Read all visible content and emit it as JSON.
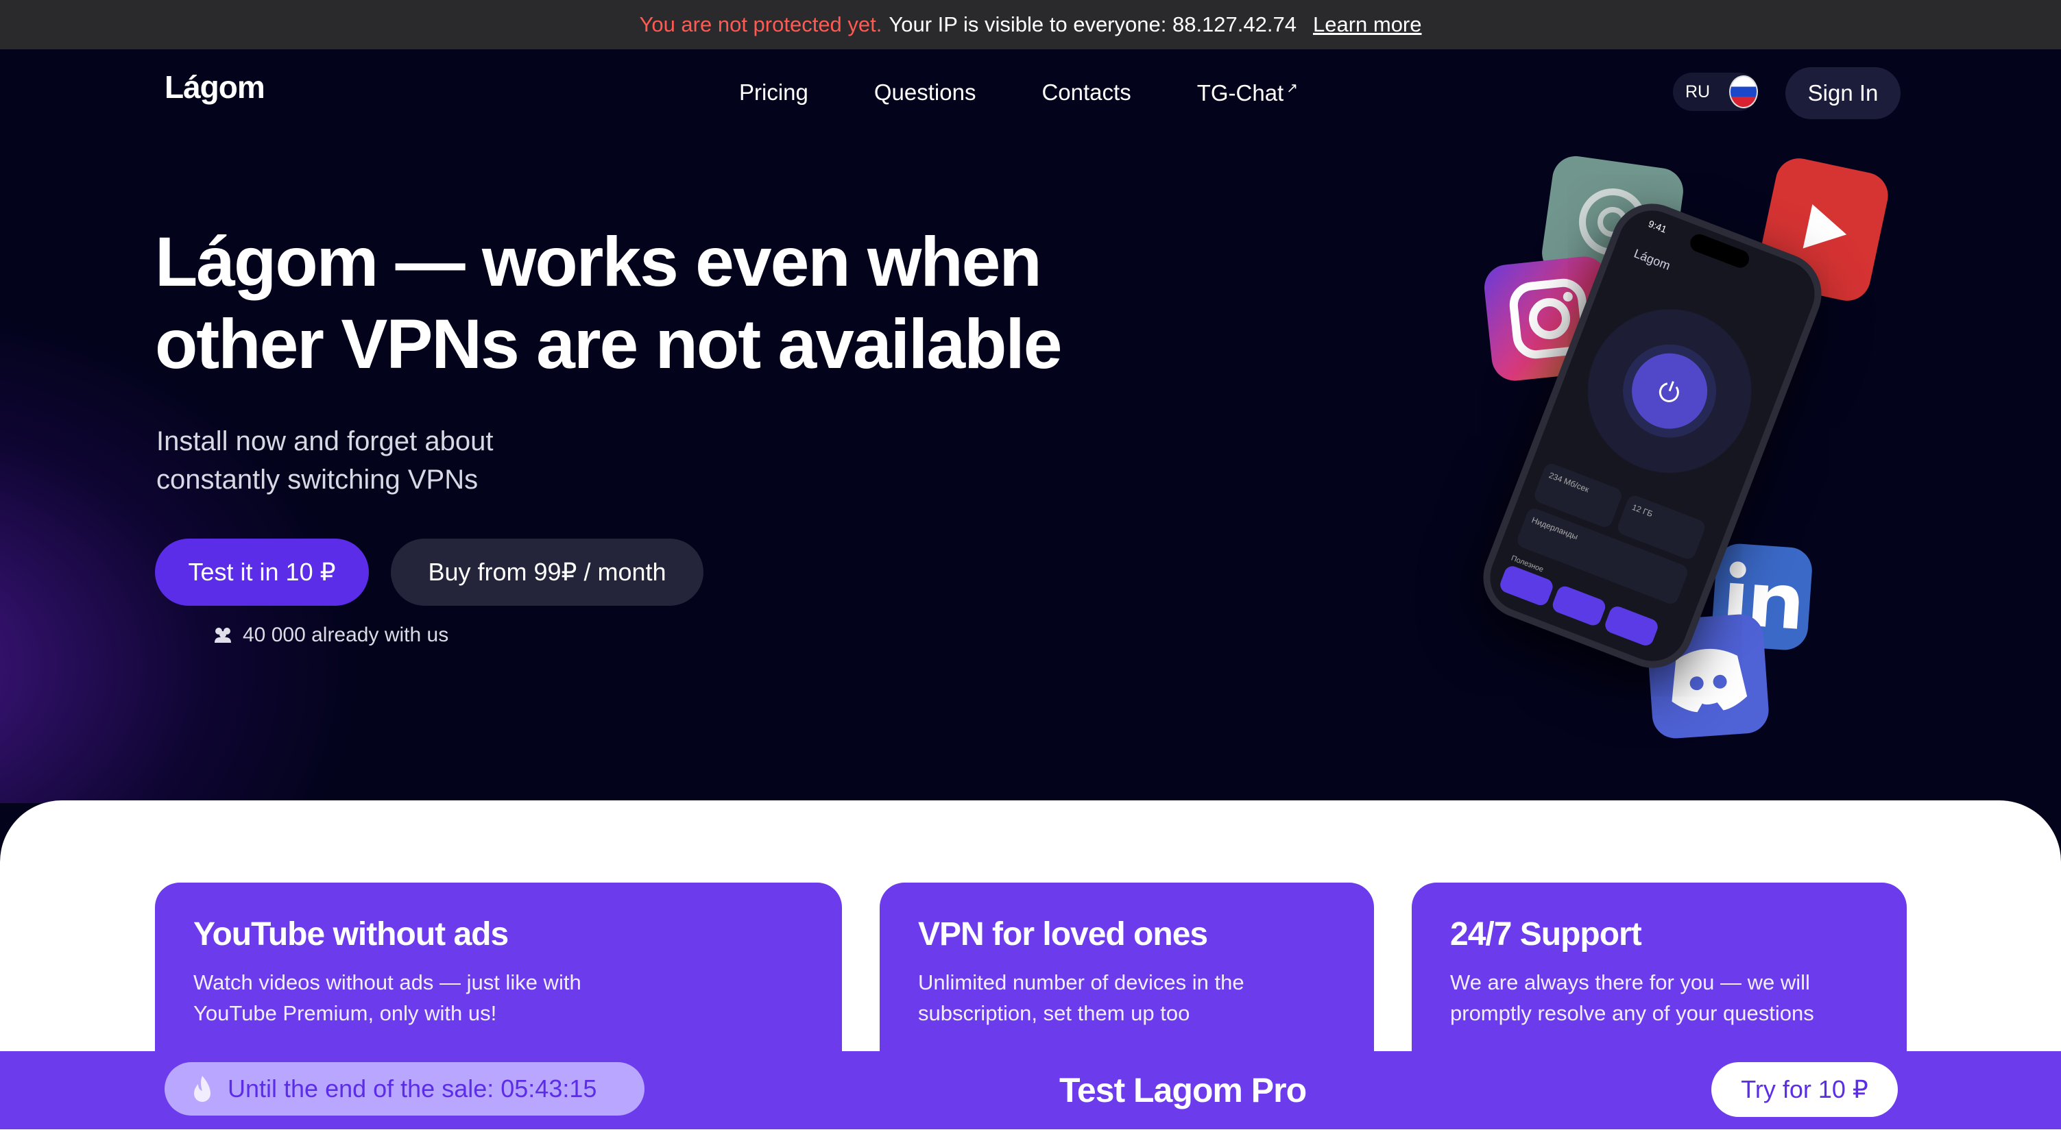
{
  "banner": {
    "warning": "You are not protected yet.",
    "info": "Your IP is visible to everyone: 88.127.42.74",
    "link": "Learn more"
  },
  "header": {
    "logo": "Lágom",
    "nav": [
      "Pricing",
      "Questions",
      "Contacts",
      "TG-Chat"
    ],
    "external_mark": "↗",
    "lang": "RU",
    "signin": "Sign In"
  },
  "hero": {
    "title_line1": "Lágom — works even when",
    "title_line2": "other VPNs are not available",
    "subtitle_line1": "Install now and forget about",
    "subtitle_line2": "constantly switching VPNs",
    "primary_btn": "Test it in 10 ₽",
    "secondary_btn": "Buy from 99₽ / month",
    "users_count": "40 000 already with us"
  },
  "phone": {
    "time": "9:41",
    "app_name": "Lágom",
    "speed": "234 Мб/сек",
    "traffic": "12 ГБ",
    "location": "Нидерланды",
    "section": "Полезное"
  },
  "features": [
    {
      "title": "YouTube without ads",
      "line1": "Watch videos without ads — just like with",
      "line2": "YouTube Premium, only with us!"
    },
    {
      "title": "VPN for loved ones",
      "line1": "Unlimited number of devices in the",
      "line2": "subscription, set them up too"
    },
    {
      "title": "24/7 Support",
      "line1": "We are always there for you — we will",
      "line2": "promptly resolve any of your questions"
    }
  ],
  "sale": {
    "timer": "Until the end of the sale: 05:43:15",
    "title": "Test Lagom Pro",
    "button": "Try for 10 ₽"
  },
  "colors": {
    "accent": "#6b3bec",
    "warning": "#ff5a52",
    "background": "#03031c"
  }
}
